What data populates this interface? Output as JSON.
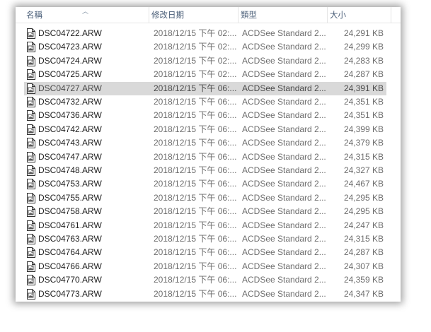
{
  "columns": {
    "name": "名稱",
    "date": "修改日期",
    "type": "類型",
    "size": "大小"
  },
  "files": [
    {
      "name": "DSC04722.ARW",
      "date": "2018/12/15 下午 02:...",
      "type": "ACDSee Standard 2...",
      "size": "24,291 KB"
    },
    {
      "name": "DSC04723.ARW",
      "date": "2018/12/15 下午 02:...",
      "type": "ACDSee Standard 2...",
      "size": "24,299 KB"
    },
    {
      "name": "DSC04724.ARW",
      "date": "2018/12/15 下午 02:...",
      "type": "ACDSee Standard 2...",
      "size": "24,283 KB"
    },
    {
      "name": "DSC04725.ARW",
      "date": "2018/12/15 下午 02:...",
      "type": "ACDSee Standard 2...",
      "size": "24,287 KB"
    },
    {
      "name": "DSC04727.ARW",
      "date": "2018/12/15 下午 06:...",
      "type": "ACDSee Standard 2...",
      "size": "24,391 KB",
      "selected": true
    },
    {
      "name": "DSC04732.ARW",
      "date": "2018/12/15 下午 06:...",
      "type": "ACDSee Standard 2...",
      "size": "24,351 KB"
    },
    {
      "name": "DSC04736.ARW",
      "date": "2018/12/15 下午 06:...",
      "type": "ACDSee Standard 2...",
      "size": "24,351 KB"
    },
    {
      "name": "DSC04742.ARW",
      "date": "2018/12/15 下午 06:...",
      "type": "ACDSee Standard 2...",
      "size": "24,399 KB"
    },
    {
      "name": "DSC04743.ARW",
      "date": "2018/12/15 下午 06:...",
      "type": "ACDSee Standard 2...",
      "size": "24,379 KB"
    },
    {
      "name": "DSC04747.ARW",
      "date": "2018/12/15 下午 06:...",
      "type": "ACDSee Standard 2...",
      "size": "24,315 KB"
    },
    {
      "name": "DSC04748.ARW",
      "date": "2018/12/15 下午 06:...",
      "type": "ACDSee Standard 2...",
      "size": "24,327 KB"
    },
    {
      "name": "DSC04753.ARW",
      "date": "2018/12/15 下午 06:...",
      "type": "ACDSee Standard 2...",
      "size": "24,467 KB"
    },
    {
      "name": "DSC04755.ARW",
      "date": "2018/12/15 下午 06:...",
      "type": "ACDSee Standard 2...",
      "size": "24,295 KB"
    },
    {
      "name": "DSC04758.ARW",
      "date": "2018/12/15 下午 06:...",
      "type": "ACDSee Standard 2...",
      "size": "24,295 KB"
    },
    {
      "name": "DSC04761.ARW",
      "date": "2018/12/15 下午 06:...",
      "type": "ACDSee Standard 2...",
      "size": "24,247 KB"
    },
    {
      "name": "DSC04763.ARW",
      "date": "2018/12/15 下午 06:...",
      "type": "ACDSee Standard 2...",
      "size": "24,315 KB"
    },
    {
      "name": "DSC04764.ARW",
      "date": "2018/12/15 下午 06:...",
      "type": "ACDSee Standard 2...",
      "size": "24,287 KB"
    },
    {
      "name": "DSC04766.ARW",
      "date": "2018/12/15 下午 06:...",
      "type": "ACDSee Standard 2...",
      "size": "24,307 KB"
    },
    {
      "name": "DSC04770.ARW",
      "date": "2018/12/15 下午 06:...",
      "type": "ACDSee Standard 2...",
      "size": "24,359 KB"
    },
    {
      "name": "DSC04773.ARW",
      "date": "2018/12/15 下午 06:...",
      "type": "ACDSee Standard 2...",
      "size": "24,347 KB"
    }
  ],
  "icons": {
    "file": "raw-image-file-icon",
    "sort": "sort-ascending-icon"
  },
  "colors": {
    "selected_row": "#d9d9d9",
    "header_text": "#4c607a"
  }
}
